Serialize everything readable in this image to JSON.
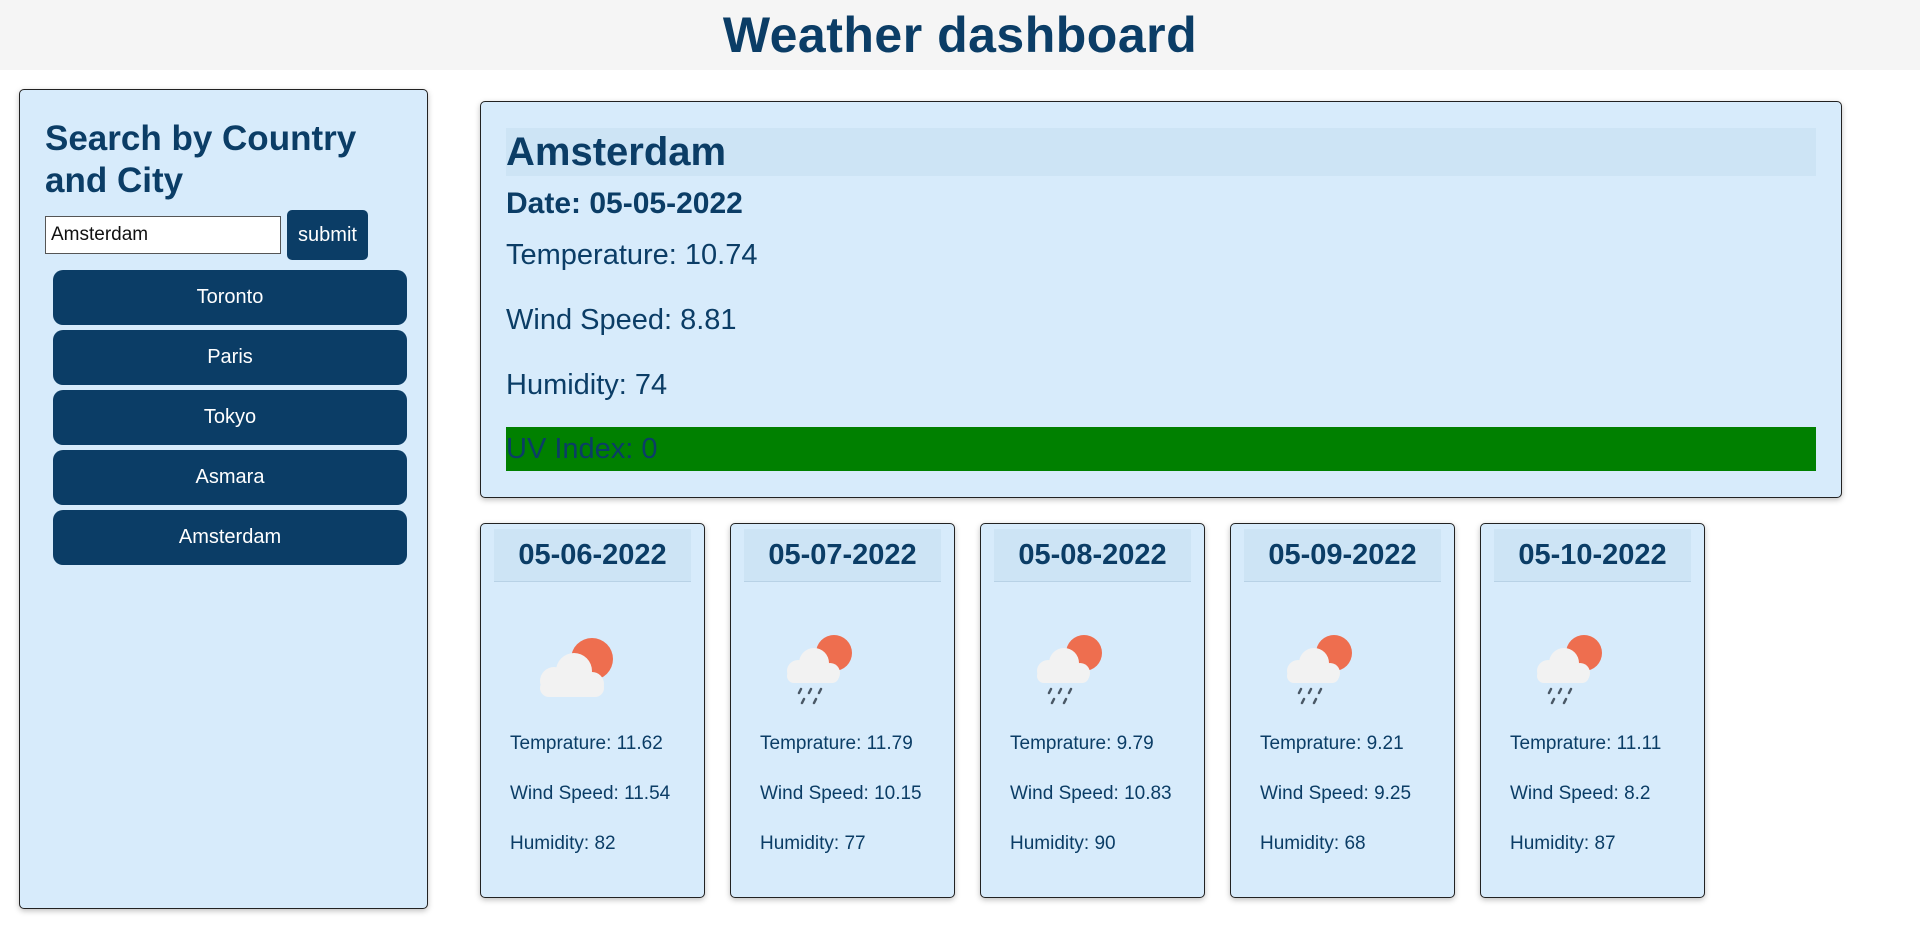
{
  "header": {
    "title": "Weather dashboard"
  },
  "sidebar": {
    "title": "Search by Country and City",
    "search_value": "Amsterdam",
    "submit_label": "submit",
    "history": [
      {
        "label": "Toronto"
      },
      {
        "label": "Paris"
      },
      {
        "label": "Tokyo"
      },
      {
        "label": "Asmara"
      },
      {
        "label": "Amsterdam"
      }
    ]
  },
  "current": {
    "city": "Amsterdam",
    "date": "Date: 05-05-2022",
    "temperature": "Temperature: 10.74",
    "wind": "Wind Speed: 8.81",
    "humidity": "Humidity: 74",
    "uv": "UV Index: 0"
  },
  "forecast": [
    {
      "date": "05-06-2022",
      "icon": "cloud-sun-icon",
      "temp": "Temprature: 11.62",
      "wind": "Wind Speed: 11.54",
      "humidity": "Humidity: 82"
    },
    {
      "date": "05-07-2022",
      "icon": "cloud-sun-rain-icon",
      "temp": "Temprature: 11.79",
      "wind": "Wind Speed: 10.15",
      "humidity": "Humidity: 77"
    },
    {
      "date": "05-08-2022",
      "icon": "cloud-sun-rain-icon",
      "temp": "Temprature: 9.79",
      "wind": "Wind Speed: 10.83",
      "humidity": "Humidity: 90"
    },
    {
      "date": "05-09-2022",
      "icon": "cloud-sun-rain-icon",
      "temp": "Temprature: 9.21",
      "wind": "Wind Speed: 9.25",
      "humidity": "Humidity: 68"
    },
    {
      "date": "05-10-2022",
      "icon": "cloud-sun-rain-icon",
      "temp": "Temprature: 11.11",
      "wind": "Wind Speed: 8.2",
      "humidity": "Humidity: 87"
    }
  ],
  "colors": {
    "primary": "#0b3d66",
    "panel": "#d7ebfb",
    "uv_low": "#008000",
    "sun": "#ee6e4f"
  }
}
